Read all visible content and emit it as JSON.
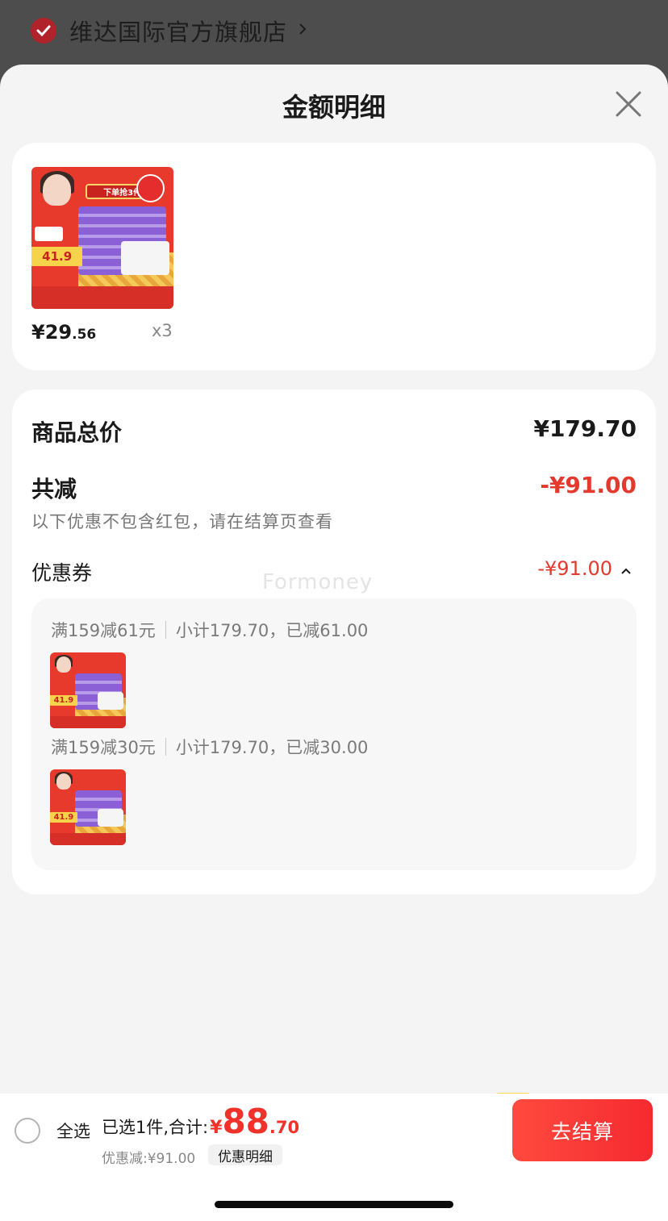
{
  "store": {
    "name": "维达国际官方旗舰店"
  },
  "sheet": {
    "title": "金额明细"
  },
  "product": {
    "price_main": "¥29",
    "price_decimal": ".56",
    "quantity": "x3",
    "thumb_banner": "下单抢3件",
    "thumb_price": "41.9"
  },
  "summary": {
    "total_label": "商品总价",
    "total_value": "¥179.70",
    "discount_label": "共减",
    "discount_value": "-¥91.00",
    "note": "以下优惠不包含红包，请在结算页查看",
    "coupon_label": "优惠券",
    "coupon_value": "-¥91.00"
  },
  "watermark": "Formoney",
  "coupons": [
    {
      "rule": "满159减61元",
      "detail": "小计179.70，已减61.00"
    },
    {
      "rule": "满159减30元",
      "detail": "小计179.70，已减30.00"
    }
  ],
  "bottom": {
    "select_all": "全选",
    "selected_text": "已选1件,合计:",
    "currency": "¥",
    "total_int": "88",
    "total_dec": ".70",
    "saved_text": "优惠减:¥91.00",
    "detail_link": "优惠明细",
    "checkout": "去结算"
  },
  "colors": {
    "accent_red": "#f0322a",
    "discount_red": "#e43a2e",
    "store_check": "#b0232b",
    "sheet_bg": "#f4f4f4"
  },
  "icons": {
    "store_check": "check-circle-icon",
    "store_chevron": "chevron-right-icon",
    "close": "close-icon",
    "coupon_toggle": "chevron-up-icon"
  }
}
